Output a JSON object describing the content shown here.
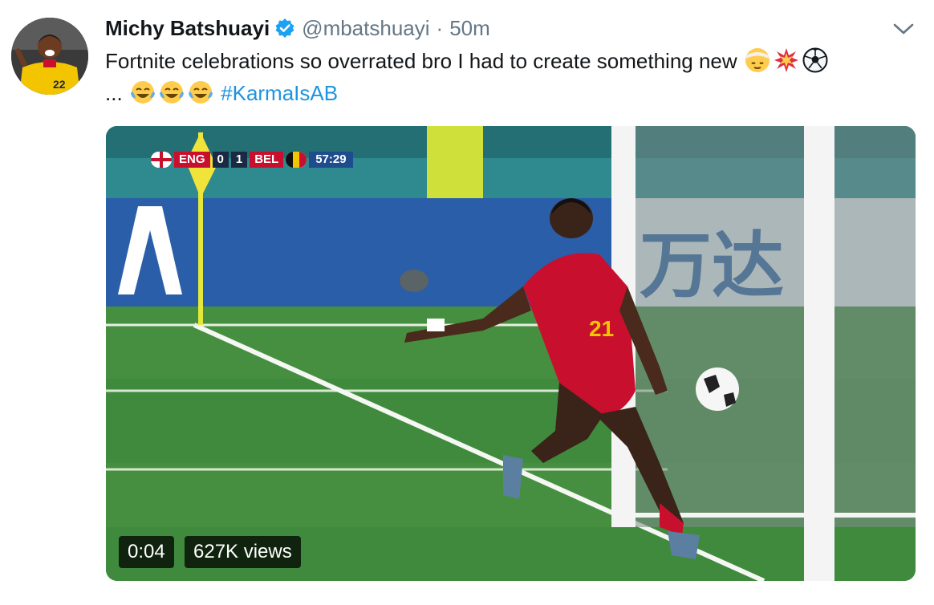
{
  "tweet": {
    "author_name": "Michy Batshuayi",
    "handle": "@mbatshuayi",
    "separator": "·",
    "time": "50m",
    "text_line1": "Fortnite celebrations so overrated bro I had to create something new",
    "text_line2_prefix": "...",
    "hashtag": "#KarmaIsAB",
    "emojis_line1": [
      "bandaged-face-emoji",
      "collision-emoji",
      "soccer-ball-emoji"
    ],
    "emojis_line2": [
      "tears-of-joy-emoji",
      "tears-of-joy-emoji",
      "tears-of-joy-emoji"
    ]
  },
  "video": {
    "scorebug": {
      "team_home": "ENG",
      "score": "0 - 1",
      "score_home": "0",
      "score_away": "1",
      "team_away": "BEL",
      "clock": "57:29"
    },
    "player_number": "21",
    "duration": "0:04",
    "views": "627K views"
  },
  "colors": {
    "hashtag": "#1b95e0",
    "verified": "#1da1f2",
    "meta_text": "#657786"
  }
}
